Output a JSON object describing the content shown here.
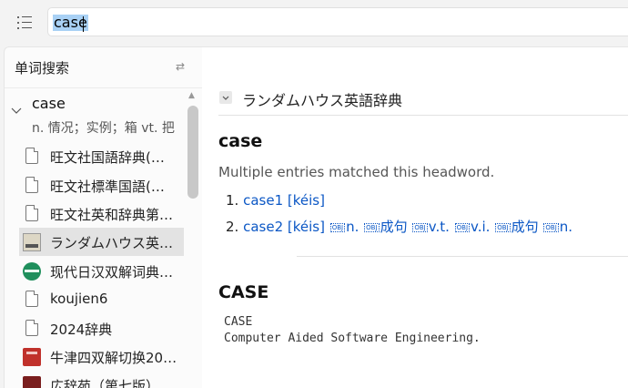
{
  "search": {
    "query": "case"
  },
  "sidebar": {
    "title": "单词搜索",
    "entry": {
      "word": "case",
      "definition": "n. 情况；实例；箱 vt. 把"
    },
    "dictionaries": [
      {
        "label": "旺文社国語辞典(…",
        "icon": "document-icon"
      },
      {
        "label": "旺文社標準国語(…",
        "icon": "document-icon"
      },
      {
        "label": "旺文社英和辞典第…",
        "icon": "document-icon"
      },
      {
        "label": "ランダムハウス英…",
        "icon": "random-house-book-icon",
        "selected": true
      },
      {
        "label": "现代日汉双解词典…",
        "icon": "green-globe-icon"
      },
      {
        "label": "koujien6",
        "icon": "document-icon"
      },
      {
        "label": "2024辞典",
        "icon": "document-icon"
      },
      {
        "label": "牛津四双解切换20…",
        "icon": "red-book-icon"
      },
      {
        "label": "広辞苑（第七版）",
        "icon": "koujien-book-icon"
      }
    ]
  },
  "main": {
    "dict_title": "ランダムハウス英語辞典",
    "headword": "case",
    "note": "Multiple entries matched this headword.",
    "results": [
      {
        "num": "1.",
        "parts": [
          "case1 [kéis]"
        ]
      },
      {
        "num": "2.",
        "text_a": "case2 [kéis] ",
        "text_b": "n. ",
        "text_c": "成句 ",
        "text_d": "v.t. ",
        "text_e": "v.i. ",
        "text_f": "成句 ",
        "text_g": "n.",
        "obj_label": "OBJ"
      }
    ],
    "headword2": "CASE",
    "lines": [
      "CASE",
      "Computer Aided Software Engineering."
    ]
  },
  "colors": {
    "link": "#0b57c5",
    "selection": "#a9d1f5",
    "selected_row": "#e3e3e3"
  }
}
